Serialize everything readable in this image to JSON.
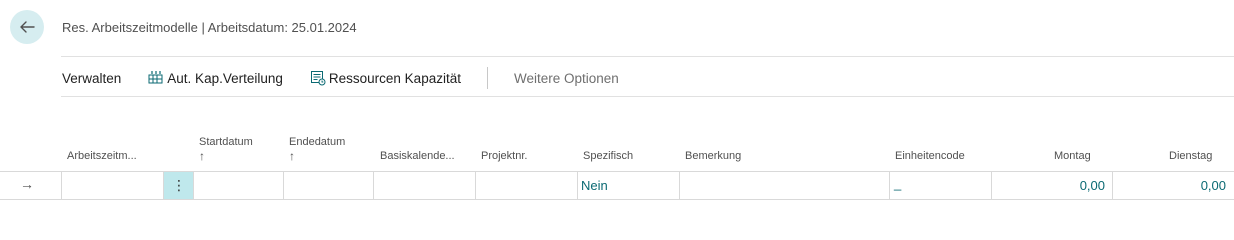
{
  "header": {
    "title": "Res. Arbeitszeitmodelle | Arbeitsdatum: 25.01.2024"
  },
  "actions": {
    "manage": "Verwalten",
    "auto_kap": "Aut. Kap.Verteilung",
    "resource_capacity": "Ressourcen Kapazität",
    "more_options": "Weitere Optionen"
  },
  "columns": {
    "arbeitszeitmodell": "Arbeitszeitm...",
    "startdatum": "Startdatum",
    "startdatum_sort": "↑",
    "endedatum": "Endedatum",
    "endedatum_sort": "↑",
    "basiskalender": "Basiskalende...",
    "projektnr": "Projektnr.",
    "spezifisch": "Spezifisch",
    "bemerkung": "Bemerkung",
    "einheitencode": "Einheitencode",
    "montag": "Montag",
    "dienstag": "Dienstag"
  },
  "row": {
    "indicator": "→",
    "menu": "⋮",
    "spezifisch": "Nein",
    "einheitencode": "_",
    "montag": "0,00",
    "dienstag": "0,00"
  },
  "colors": {
    "accent": "#0b6a73",
    "back_button_bg": "#d6edf0",
    "selected_cell_bg": "#bfe8ec"
  }
}
